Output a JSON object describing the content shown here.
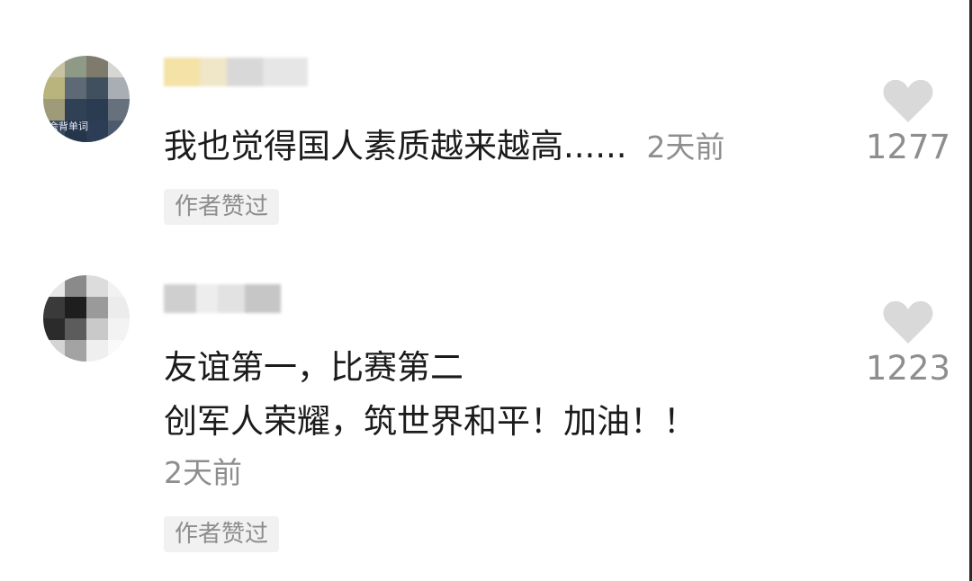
{
  "comments": [
    {
      "avatar_caption": "会背单词",
      "text_lines": [
        "我也觉得国人素质越来越高......"
      ],
      "time": "2天前",
      "liked_tag": "作者赞过",
      "like_count": "1277",
      "like_icon": "heart-icon"
    },
    {
      "avatar_caption": "",
      "text_lines": [
        "友谊第一，比赛第二",
        "创军人荣耀，筑世界和平！加油！！"
      ],
      "time": "2天前",
      "liked_tag": "作者赞过",
      "like_count": "1223",
      "like_icon": "heart-icon"
    }
  ],
  "colors": {
    "text": "#1b1b1b",
    "meta": "#8e8e8e",
    "tag_bg": "#f1f1f1",
    "heart": "#d9d9d9"
  }
}
